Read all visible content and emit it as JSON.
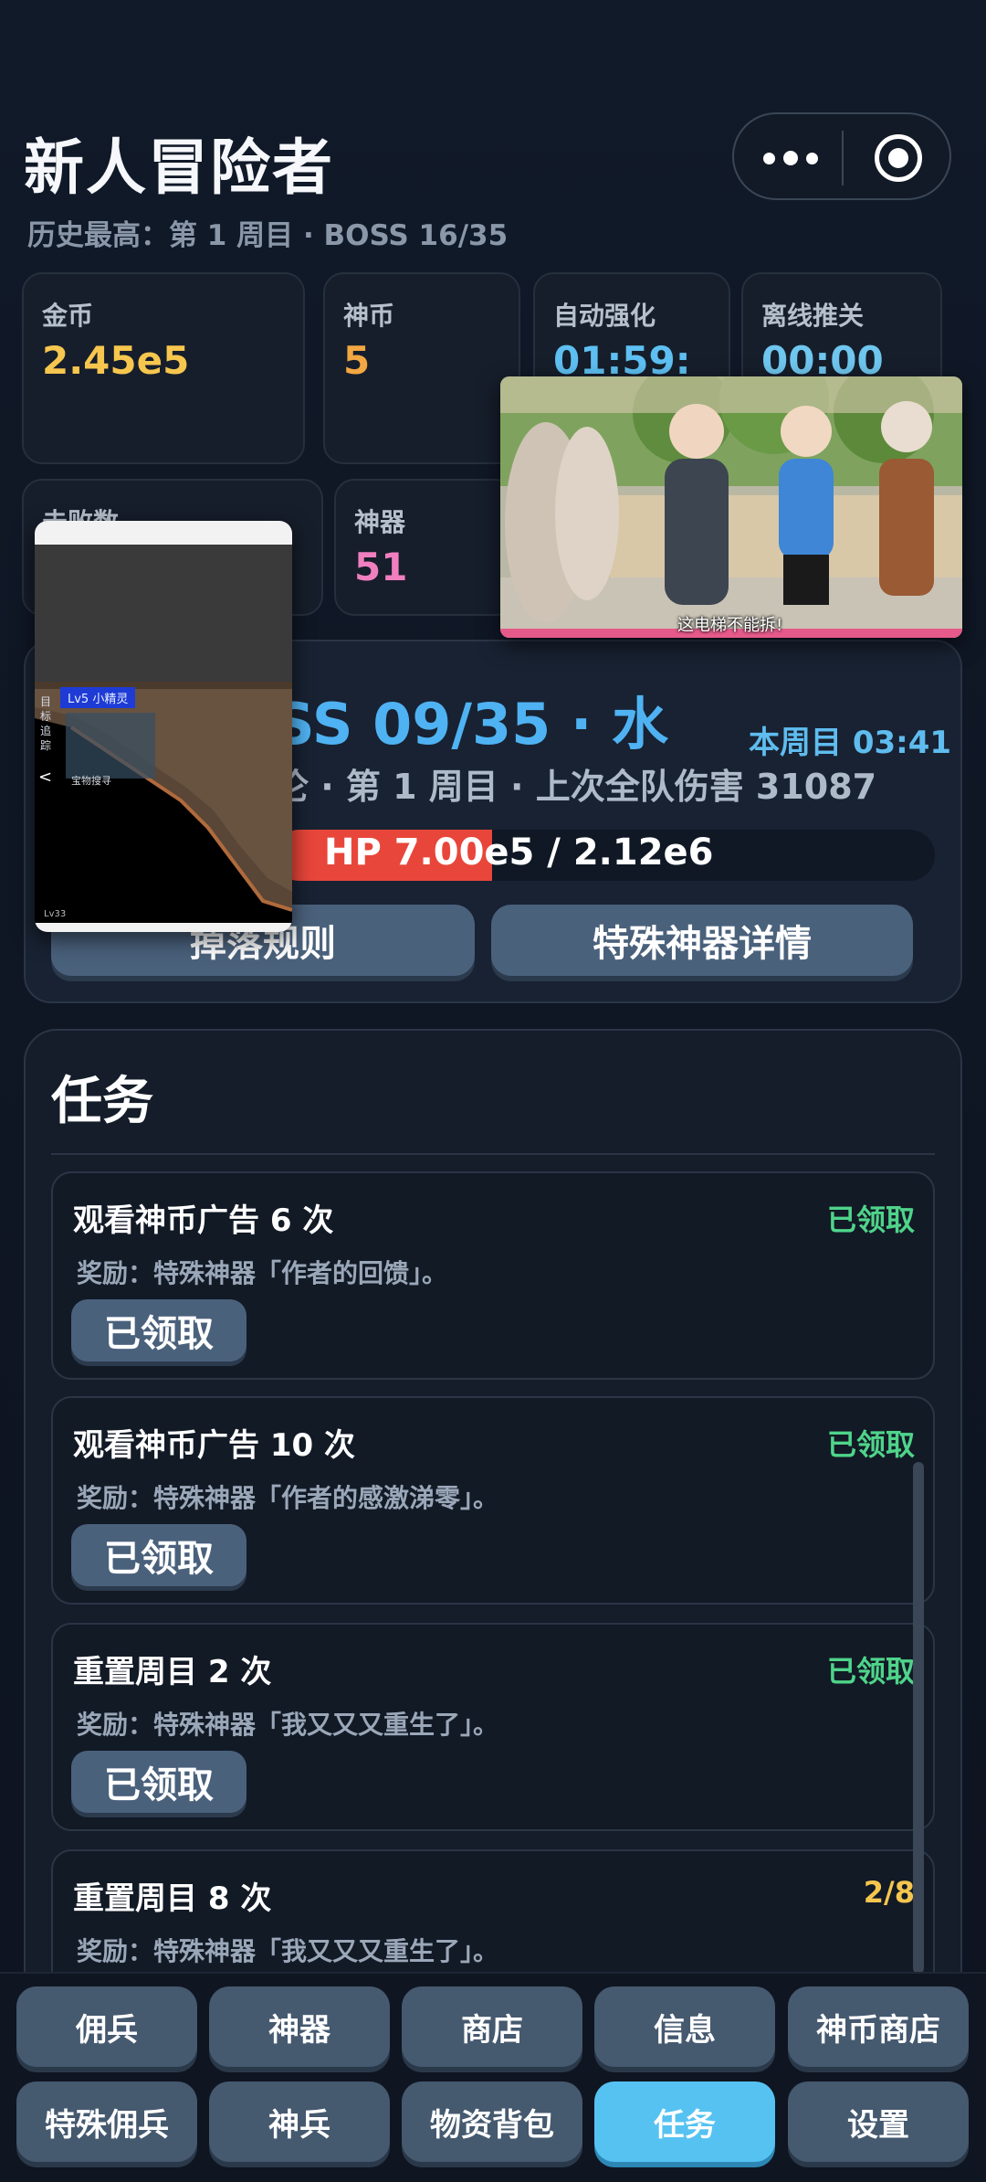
{
  "header": {
    "title": "新人冒险者",
    "subtitle": "历史最高：第 1 周目 · BOSS 16/35"
  },
  "capsule": {
    "more_icon": "more-dots-icon",
    "close_icon": "target-circle-icon"
  },
  "stats_row1": [
    {
      "label": "金币",
      "value": "2.45e5",
      "color": "#f6c64e"
    },
    {
      "label": "神币",
      "value": "5",
      "color": "#f3a742"
    },
    {
      "label": "自动强化",
      "value": "01:59:",
      "color": "#5ec0f2"
    },
    {
      "label": "离线推关",
      "value": "00:00",
      "color": "#6fc6ee"
    }
  ],
  "stats_row2": [
    {
      "label": "击败数",
      "value": "",
      "color": "#f3a742"
    },
    {
      "label": "神器",
      "value": "51",
      "color": "#f07fc0"
    }
  ],
  "boss": {
    "title": "SS 09/35 · 水",
    "round": "本周目 03:41",
    "info": "伦 · 第 1 周目 · 上次全队伤害 31087",
    "hp_text": "HP 7.00e5 / 2.12e6",
    "hp_fraction": 0.33,
    "drop_rules_button": "掉落规则",
    "special_button": "特殊神器详情"
  },
  "tasks": {
    "heading": "任务",
    "items": [
      {
        "title": "观看神币广告 6 次",
        "status": "已领取",
        "status_color": "#4fd48a",
        "reward": "奖励：特殊神器「作者的回馈」。",
        "button": "已领取"
      },
      {
        "title": "观看神币广告 10 次",
        "status": "已领取",
        "status_color": "#4fd48a",
        "reward": "奖励：特殊神器「作者的感激涕零」。",
        "button": "已领取"
      },
      {
        "title": "重置周目 2 次",
        "status": "已领取",
        "status_color": "#4fd48a",
        "reward": "奖励：特殊神器「我又又又重生了」。",
        "button": "已领取"
      },
      {
        "title": "重置周目 8 次",
        "status": "2/8",
        "status_color": "#f6c64e",
        "reward": "奖励：特殊神器「我又又又重生了」。",
        "button": ""
      }
    ]
  },
  "nav": {
    "row1": [
      "佣兵",
      "神器",
      "商店",
      "信息",
      "神币商店"
    ],
    "row2": [
      "特殊佣兵",
      "神兵",
      "物资背包",
      "任务",
      "设置"
    ],
    "active": "任务"
  },
  "overlay_game": {
    "badge": "Lv5 小精灵",
    "side_text": "目\n标\n追\n踪",
    "arrow": "<",
    "label": "宝物搜寻",
    "level": "Lv33"
  },
  "overlay_video": {
    "caption": "这电梯不能拆!"
  }
}
